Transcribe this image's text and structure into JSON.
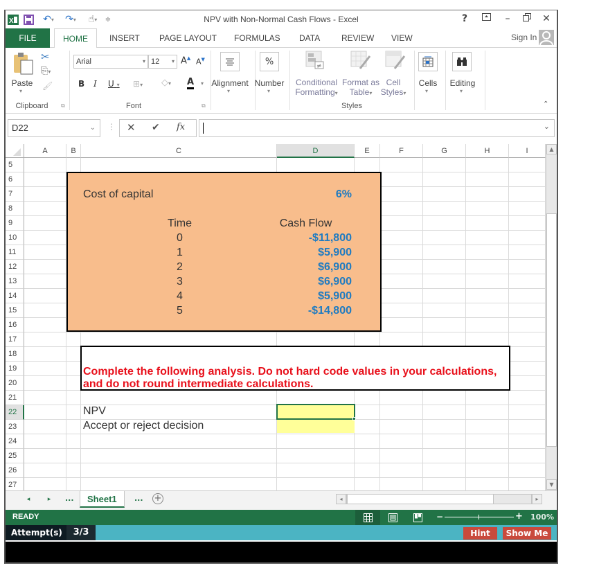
{
  "window": {
    "title": "NPV with Non-Normal Cash Flows - Excel",
    "controls": {
      "help": "?",
      "ribbon_display": "⧈",
      "minimize": "—",
      "restore": "❐",
      "close": "✕"
    },
    "sign_in": "Sign In"
  },
  "quick_access": {
    "icons": [
      "excel-logo-icon",
      "save-icon",
      "undo-icon",
      "redo-icon",
      "touch-mode-icon",
      "customize-qat-icon"
    ]
  },
  "ribbon_tabs": [
    {
      "label": "FILE"
    },
    {
      "label": "HOME",
      "active": true
    },
    {
      "label": "INSERT"
    },
    {
      "label": "PAGE LAYOUT"
    },
    {
      "label": "FORMULAS"
    },
    {
      "label": "DATA"
    },
    {
      "label": "REVIEW"
    },
    {
      "label": "VIEW"
    }
  ],
  "ribbon": {
    "clipboard": {
      "paste": "Paste",
      "group_label": "Clipboard"
    },
    "font": {
      "name": "Arial",
      "size": "12",
      "bold": "B",
      "italic": "I",
      "underline": "U",
      "font_color_letter": "A",
      "grow": "A",
      "shrink": "A",
      "group_label": "Font"
    },
    "alignment": {
      "label": "Alignment"
    },
    "number": {
      "label": "Number",
      "icon_text": "%"
    },
    "styles": {
      "conditional_formatting": [
        "Conditional",
        "Formatting"
      ],
      "format_as_table": [
        "Format as",
        "Table"
      ],
      "cell_styles": [
        "Cell",
        "Styles"
      ],
      "group_label": "Styles"
    },
    "cells": {
      "label": "Cells"
    },
    "editing": {
      "label": "Editing"
    }
  },
  "formula_bar": {
    "name_box": "D22",
    "formula_value": "",
    "cancel": "✕",
    "enter": "✔",
    "fx": "fx"
  },
  "columns": [
    "A",
    "B",
    "C",
    "D",
    "E",
    "F",
    "G",
    "H",
    "I"
  ],
  "selected_column": "D",
  "rows": [
    "5",
    "6",
    "7",
    "8",
    "9",
    "10",
    "11",
    "12",
    "13",
    "14",
    "15",
    "16",
    "17",
    "18",
    "19",
    "20",
    "21",
    "22",
    "23",
    "24",
    "25",
    "26",
    "27"
  ],
  "selected_row": "22",
  "sheet": {
    "cost_of_capital_label": "Cost of capital",
    "cost_of_capital_value": "6%",
    "time_header": "Time",
    "cash_flow_header": "Cash Flow",
    "cash_flows": [
      {
        "time": "0",
        "amount": "-$11,800"
      },
      {
        "time": "1",
        "amount": "$5,900"
      },
      {
        "time": "2",
        "amount": "$6,900"
      },
      {
        "time": "3",
        "amount": "$6,900"
      },
      {
        "time": "4",
        "amount": "$5,900"
      },
      {
        "time": "5",
        "amount": "-$14,800"
      }
    ],
    "instruction_line1": "Complete the following analysis. Do not hard code values in your calculations,",
    "instruction_line2": "and do not round intermediate calculations.",
    "npv_label": "NPV",
    "npv_value": "",
    "decision_label": "Accept or reject decision",
    "decision_value": ""
  },
  "sheet_tabs": {
    "active": "Sheet1",
    "ellipsis": "...",
    "add": "+"
  },
  "status": {
    "text": "READY",
    "zoom": "100%",
    "zoom_minus": "−",
    "zoom_plus": "+"
  },
  "attempts": {
    "label": "Attempt(s)",
    "value": "3/3",
    "hint": "Hint",
    "show_me": "Show Me"
  },
  "colors": {
    "excel_green": "#217346",
    "orange_fill": "#f8bd8c",
    "value_blue": "#1f7bc1",
    "instruction_red": "#e8101b",
    "input_yellow": "#ffff99",
    "attempts_bar": "#4bb4c3",
    "button_red": "#c94a3c"
  }
}
